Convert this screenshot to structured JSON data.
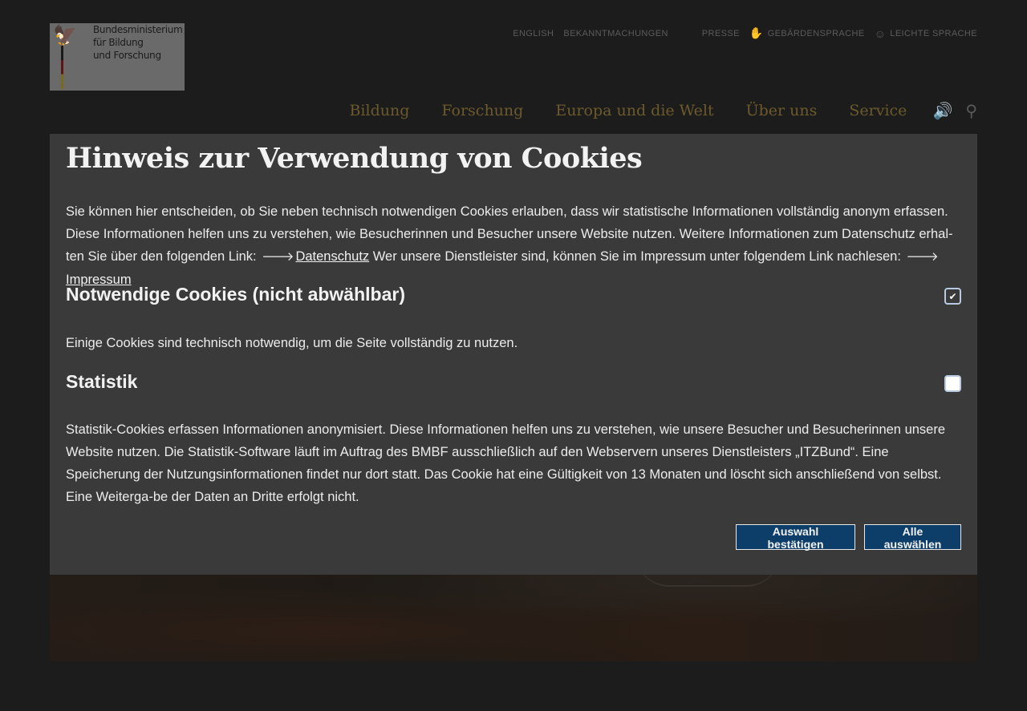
{
  "logo": {
    "line1": "Bundesministerium",
    "line2": "für Bildung",
    "line3": "und Forschung"
  },
  "meta_nav": {
    "english": "ENGLISH",
    "announcements": "BEKANNTMACHUNGEN",
    "press": "PRESSE",
    "sign_language": "GEBÄRDENSPRACHE",
    "easy_language": "LEICHTE SPRACHE"
  },
  "main_nav": {
    "items": [
      "Bildung",
      "Forschung",
      "Europa und die Welt",
      "Über uns",
      "Service"
    ]
  },
  "cookie_dialog": {
    "title": "Hinweis zur Verwendung von Cookies",
    "intro_text": "Sie können hier entscheiden, ob Sie neben technisch notwendigen Cookies erlauben, dass wir statistische Informationen vollständig anonym erfassen. Diese Informationen helfen uns zu verstehen, wie Besucherinnen und Besucher unsere Website nutzen. Weitere Informationen zum Datenschutz erhal-ten Sie über den folgenden Link:",
    "privacy_link": "Datenschutz",
    "imprint_text": "Wer unsere Dienstleister sind, können Sie im Impressum unter folgendem Link nachlesen:",
    "imprint_link": "Impressum",
    "necessary_title": "Notwendige Cookies (nicht abwählbar)",
    "necessary_checked": true,
    "necessary_desc": "Einige Cookies sind technisch notwendig, um die Seite vollständig zu nutzen.",
    "statistics_title": "Statistik",
    "statistics_checked": false,
    "statistics_desc": "Statistik-Cookies erfassen Informationen anonymisiert. Diese Informationen helfen uns zu verstehen, wie unsere Besucher und Besucherinnen unsere Website nutzen. Die Statistik-Software läuft im Auftrag des BMBF ausschließlich auf den Webservern unseres Dienstleisters „ITZBund“. Eine Speicherung der Nutzungsinformationen findet nur dort statt. Das Cookie hat eine Gültigkeit von 13 Monaten und löscht sich anschließend von selbst. Eine Weiterga-be der Daten an Dritte erfolgt nicht.",
    "confirm_button": "Auswahl bestätigen",
    "select_all_button": "Alle auswählen"
  },
  "colors": {
    "button_bg": "#0d3e69",
    "dialog_bg": "#3a3a3a"
  },
  "icons": {
    "audio": "speaker-icon",
    "search": "search-icon",
    "arrow": "arrow-right-icon",
    "check": "checkmark-icon"
  }
}
